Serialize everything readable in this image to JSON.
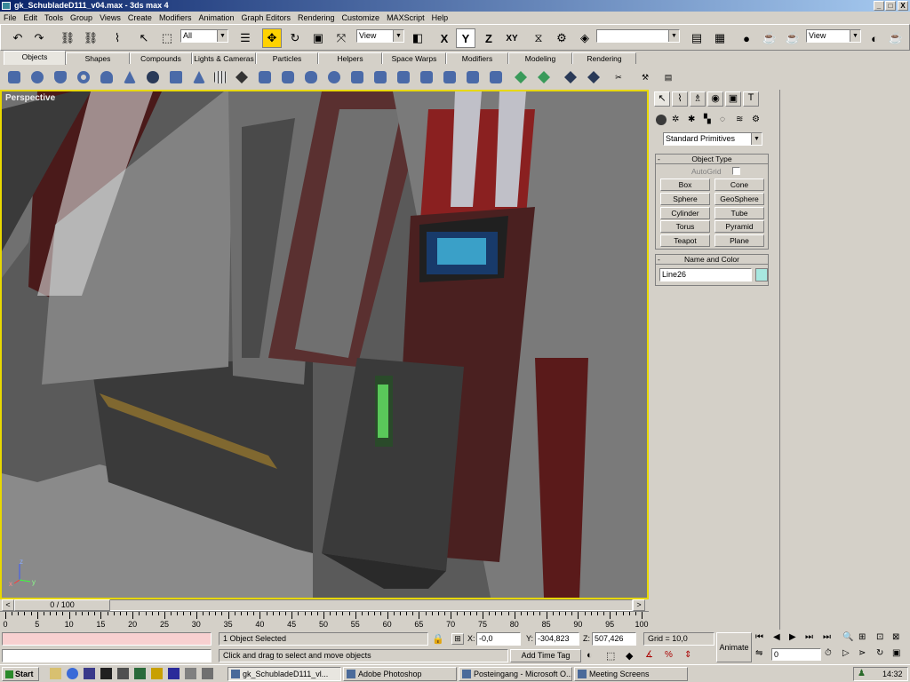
{
  "window": {
    "title": "gk_SchubladeD111_v04.max - 3ds max 4",
    "buttons": [
      "_",
      "□",
      "X"
    ]
  },
  "menu": [
    "File",
    "Edit",
    "Tools",
    "Group",
    "Views",
    "Create",
    "Modifiers",
    "Animation",
    "Graph Editors",
    "Rendering",
    "Customize",
    "MAXScript",
    "Help"
  ],
  "toolbar": {
    "selection_filter": "All",
    "ref_coord": "View",
    "axis_x": "X",
    "axis_y": "Y",
    "axis_z": "Z",
    "axis_xy": "XY",
    "named_sel": "",
    "render_type": "View"
  },
  "tabs": [
    "Objects",
    "Shapes",
    "Compounds",
    "Lights & Cameras",
    "Particles",
    "Helpers",
    "Space Warps",
    "Modifiers",
    "Modeling",
    "Rendering"
  ],
  "viewport": {
    "label": "Perspective",
    "axis_z": "z",
    "axis_x": "x",
    "axis_y": "y"
  },
  "command_panel": {
    "category": "Standard Primitives",
    "object_type_title": "Object Type",
    "autogrid": "AutoGrid",
    "primitives": [
      "Box",
      "Cone",
      "Sphere",
      "GeoSphere",
      "Cylinder",
      "Tube",
      "Torus",
      "Pyramid",
      "Teapot",
      "Plane"
    ],
    "name_color_title": "Name and Color",
    "object_name": "Line26",
    "object_color": "#a8e8e0",
    "rollout_minus": "-"
  },
  "timeline": {
    "frame": "0 / 100",
    "prev": "<",
    "next": ">",
    "ticks": [
      "0",
      "5",
      "10",
      "15",
      "20",
      "25",
      "30",
      "35",
      "40",
      "45",
      "50",
      "55",
      "60",
      "65",
      "70",
      "75",
      "80",
      "85",
      "90",
      "95",
      "100"
    ]
  },
  "status": {
    "selection": "1 Object Selected",
    "prompt": "Click and drag to select and move objects",
    "x_label": "X:",
    "x": "-0,0",
    "y_label": "Y:",
    "y": "-304,823",
    "z_label": "Z:",
    "z": "507,426",
    "grid": "Grid = 10,0",
    "add_time_tag": "Add Time Tag",
    "animate": "Animate",
    "frame_field": "0"
  },
  "taskbar": {
    "start": "Start",
    "tasks": [
      "gk_SchubladeD111_vl...",
      "Adobe Photoshop",
      "Posteingang - Microsoft O...",
      "Meeting Screens"
    ],
    "clock": "14:32"
  },
  "colors": {
    "title_start": "#0a246a",
    "viewport_border": "#e8d800",
    "toolbar_active": "#ffd200"
  }
}
